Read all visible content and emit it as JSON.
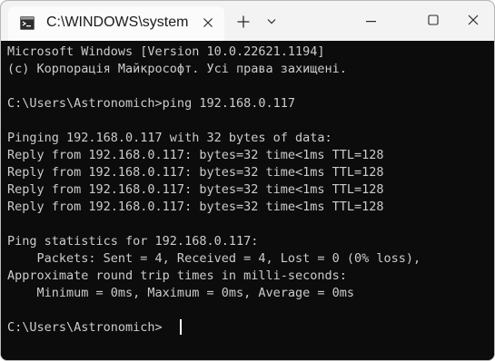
{
  "window": {
    "tab_title": "C:\\WINDOWS\\system",
    "icons": {
      "tab": "cmd-terminal-icon",
      "close_tab": "close-icon",
      "new_tab": "plus-icon",
      "dropdown": "chevron-down-icon",
      "minimize": "minimize-icon",
      "maximize": "maximize-icon",
      "close_window": "close-icon"
    },
    "colors": {
      "titlebar": "#f3f3f3",
      "tab": "#fbfbfb",
      "console_bg": "#0c0c0c",
      "console_text": "#cccccc"
    }
  },
  "console": {
    "lines": [
      "Microsoft Windows [Version 10.0.22621.1194]",
      "(c) Корпорація Майкрософт. Усі права захищені.",
      "",
      "C:\\Users\\Astronomich>ping 192.168.0.117",
      "",
      "Pinging 192.168.0.117 with 32 bytes of data:",
      "Reply from 192.168.0.117: bytes=32 time<1ms TTL=128",
      "Reply from 192.168.0.117: bytes=32 time<1ms TTL=128",
      "Reply from 192.168.0.117: bytes=32 time<1ms TTL=128",
      "Reply from 192.168.0.117: bytes=32 time<1ms TTL=128",
      "",
      "Ping statistics for 192.168.0.117:",
      "    Packets: Sent = 4, Received = 4, Lost = 0 (0% loss),",
      "Approximate round trip times in milli-seconds:",
      "    Minimum = 0ms, Maximum = 0ms, Average = 0ms",
      "",
      "C:\\Users\\Astronomich>"
    ]
  }
}
